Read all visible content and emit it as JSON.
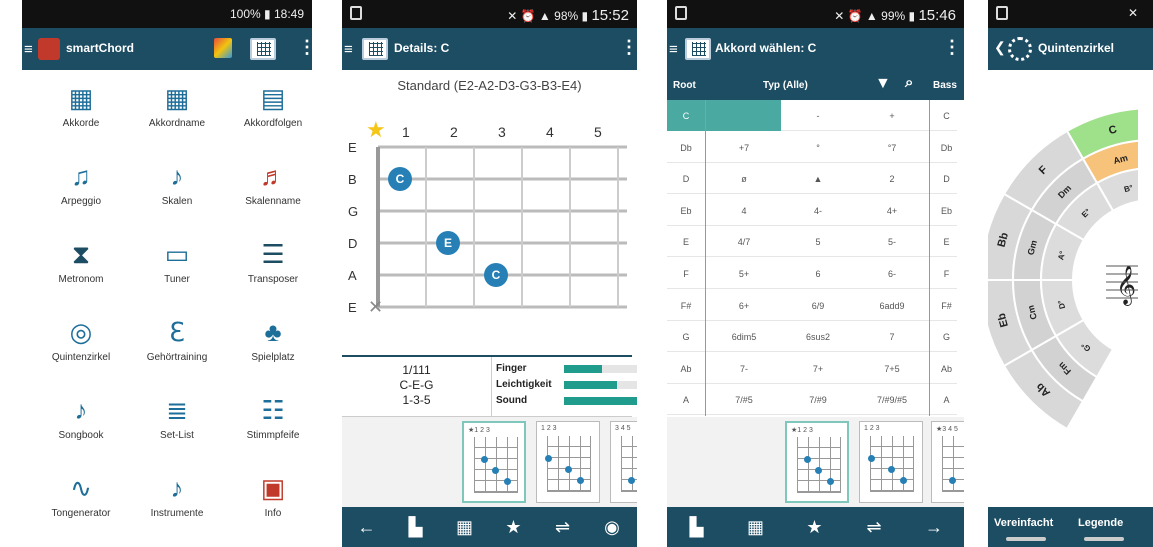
{
  "phone1": {
    "status_time": "18:49",
    "status_batt": "100%",
    "app_title": "smartChord",
    "menu": [
      {
        "label": "Akkorde",
        "icon": "chord-grid-icon"
      },
      {
        "label": "Akkordname",
        "icon": "chord-name-icon"
      },
      {
        "label": "Akkordfolgen",
        "icon": "chord-progression-icon"
      },
      {
        "label": "Arpeggio",
        "icon": "arpeggio-icon"
      },
      {
        "label": "Skalen",
        "icon": "scales-icon"
      },
      {
        "label": "Skalenname",
        "icon": "scale-name-icon"
      },
      {
        "label": "Metronom",
        "icon": "metronome-icon"
      },
      {
        "label": "Tuner",
        "icon": "tuner-icon"
      },
      {
        "label": "Transposer",
        "icon": "transposer-icon"
      },
      {
        "label": "Quintenzirkel",
        "icon": "circle-of-fifths-icon"
      },
      {
        "label": "Gehörtraining",
        "icon": "ear-training-icon"
      },
      {
        "label": "Spielplatz",
        "icon": "playground-icon"
      },
      {
        "label": "Songbook",
        "icon": "songbook-icon"
      },
      {
        "label": "Set-List",
        "icon": "setlist-icon"
      },
      {
        "label": "Stimmpfeife",
        "icon": "pitch-pipe-icon"
      },
      {
        "label": "Tongenerator",
        "icon": "tone-generator-icon"
      },
      {
        "label": "Instrumente",
        "icon": "guitar-icon"
      },
      {
        "label": "Info",
        "icon": "info-logo-icon"
      }
    ]
  },
  "phone2": {
    "status_time": "15:52",
    "status_batt": "98%",
    "title": "Details: C",
    "tuning": "Standard (E2-A2-D3-G3-B3-E4)",
    "fret_numbers": [
      "1",
      "2",
      "3",
      "4",
      "5"
    ],
    "strings": [
      "E",
      "B",
      "G",
      "D",
      "A",
      "E"
    ],
    "notes": [
      {
        "string": 1,
        "fret": 1,
        "label": "C"
      },
      {
        "string": 3,
        "fret": 2,
        "label": "E"
      },
      {
        "string": 4,
        "fret": 3,
        "label": "C"
      }
    ],
    "info_lines": [
      "1/111",
      "C-E-G",
      "1-3-5"
    ],
    "ratings": [
      {
        "label": "Finger",
        "value": 0.5
      },
      {
        "label": "Leichtigkeit",
        "value": 0.7
      },
      {
        "label": "Sound",
        "value": 0.98
      }
    ],
    "accent": "#1d4d63",
    "bar_color": "#1f9c8c"
  },
  "phone3": {
    "status_time": "15:46",
    "status_batt": "99%",
    "title": "Akkord wählen: C",
    "col_root": "Root",
    "col_type": "Typ (Alle)",
    "col_bass": "Bass",
    "rows": [
      {
        "root": "C",
        "a": "",
        "b": "-",
        "c": "+",
        "bass": "C"
      },
      {
        "root": "Db",
        "a": "+7",
        "b": "°",
        "c": "°7",
        "bass": "Db"
      },
      {
        "root": "D",
        "a": "ø",
        "b": "▲",
        "c": "2",
        "bass": "D"
      },
      {
        "root": "Eb",
        "a": "4",
        "b": "4-",
        "c": "4+",
        "bass": "Eb"
      },
      {
        "root": "E",
        "a": "4/7",
        "b": "5",
        "c": "5-",
        "bass": "E"
      },
      {
        "root": "F",
        "a": "5+",
        "b": "6",
        "c": "6-",
        "bass": "F"
      },
      {
        "root": "F#",
        "a": "6+",
        "b": "6/9",
        "c": "6add9",
        "bass": "F#"
      },
      {
        "root": "G",
        "a": "6dim5",
        "b": "6sus2",
        "c": "7",
        "bass": "G"
      },
      {
        "root": "Ab",
        "a": "7-",
        "b": "7+",
        "c": "7+5",
        "bass": "Ab"
      },
      {
        "root": "A",
        "a": "7/#5",
        "b": "7/#9",
        "c": "7/#9/#5",
        "bass": "A"
      }
    ],
    "selected_color": "#4aa9a0"
  },
  "phone4": {
    "title": "Quintenzirkel",
    "btn_simplified": "Vereinfacht",
    "btn_legend": "Legende",
    "outer_keys": [
      "C",
      "F",
      "Bb",
      "Eb",
      "Ab"
    ],
    "middle_keys": [
      "Am",
      "Dm",
      "Gm",
      "Cm",
      "Fm"
    ],
    "inner_keys": [
      "B°",
      "E°",
      "A°",
      "D°",
      "G°"
    ],
    "cut_keys": [
      "E",
      "F"
    ]
  }
}
